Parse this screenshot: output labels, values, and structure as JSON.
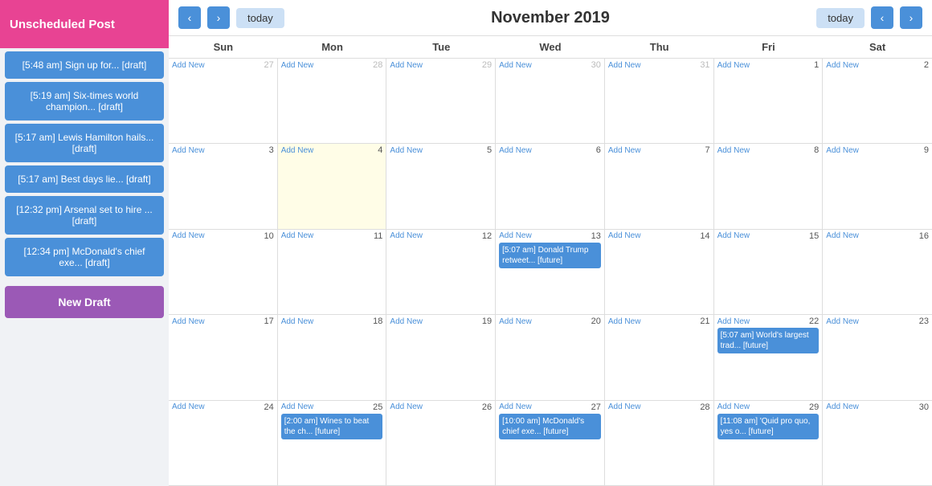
{
  "sidebar": {
    "unscheduled_label": "Unscheduled Post",
    "drafts": [
      "[5:48 am] Sign up for... [draft]",
      "[5:19 am] Six-times world champion... [draft]",
      "[5:17 am] Lewis Hamilton hails... [draft]",
      "[5:17 am] Best days lie... [draft]",
      "[12:32 pm] Arsenal set to hire ... [draft]",
      "[12:34 pm] McDonald's chief exe... [draft]"
    ],
    "new_draft_label": "New Draft"
  },
  "header": {
    "today_label_left": "today",
    "month_title": "November 2019",
    "today_label_right": "today",
    "prev_icon": "‹",
    "next_icon": "›"
  },
  "calendar": {
    "day_headers": [
      "Sun",
      "Mon",
      "Tue",
      "Wed",
      "Thu",
      "Fri",
      "Sat"
    ],
    "weeks": [
      [
        {
          "date": 27,
          "out": true,
          "add": true
        },
        {
          "date": 28,
          "out": true,
          "add": true
        },
        {
          "date": 29,
          "out": true,
          "add": true
        },
        {
          "date": 30,
          "out": true,
          "add": true
        },
        {
          "date": 31,
          "out": true,
          "add": true
        },
        {
          "date": 1,
          "out": false,
          "add": true
        },
        {
          "date": 2,
          "out": false,
          "add": true
        }
      ],
      [
        {
          "date": 3,
          "out": false,
          "add": true
        },
        {
          "date": 4,
          "out": false,
          "add": true,
          "today": true
        },
        {
          "date": 5,
          "out": false,
          "add": true
        },
        {
          "date": 6,
          "out": false,
          "add": true
        },
        {
          "date": 7,
          "out": false,
          "add": true
        },
        {
          "date": 8,
          "out": false,
          "add": true
        },
        {
          "date": 9,
          "out": false,
          "add": true
        }
      ],
      [
        {
          "date": 10,
          "out": false,
          "add": true
        },
        {
          "date": 11,
          "out": false,
          "add": true
        },
        {
          "date": 12,
          "out": false,
          "add": true
        },
        {
          "date": 13,
          "out": false,
          "add": true,
          "event": "[5:07 am] Donald Trump retweet... [future]"
        },
        {
          "date": 14,
          "out": false,
          "add": true
        },
        {
          "date": 15,
          "out": false,
          "add": true
        },
        {
          "date": 16,
          "out": false,
          "add": true
        }
      ],
      [
        {
          "date": 17,
          "out": false,
          "add": true
        },
        {
          "date": 18,
          "out": false,
          "add": true
        },
        {
          "date": 19,
          "out": false,
          "add": true
        },
        {
          "date": 20,
          "out": false,
          "add": true
        },
        {
          "date": 21,
          "out": false,
          "add": true
        },
        {
          "date": 22,
          "out": false,
          "add": true,
          "event": "[5:07 am] World's largest trad... [future]"
        },
        {
          "date": 23,
          "out": false,
          "add": true
        }
      ],
      [
        {
          "date": 24,
          "out": false,
          "add": true
        },
        {
          "date": 25,
          "out": false,
          "add": true,
          "event": "[2:00 am] Wines to beat the ch... [future]"
        },
        {
          "date": 26,
          "out": false,
          "add": true
        },
        {
          "date": 27,
          "out": false,
          "add": true,
          "event": "[10:00 am] McDonald's chief exe... [future]"
        },
        {
          "date": 28,
          "out": false,
          "add": true
        },
        {
          "date": 29,
          "out": false,
          "add": true,
          "event": "[11:08 am] 'Quid pro quo, yes o... [future]"
        },
        {
          "date": 30,
          "out": false,
          "add": true
        }
      ]
    ]
  }
}
